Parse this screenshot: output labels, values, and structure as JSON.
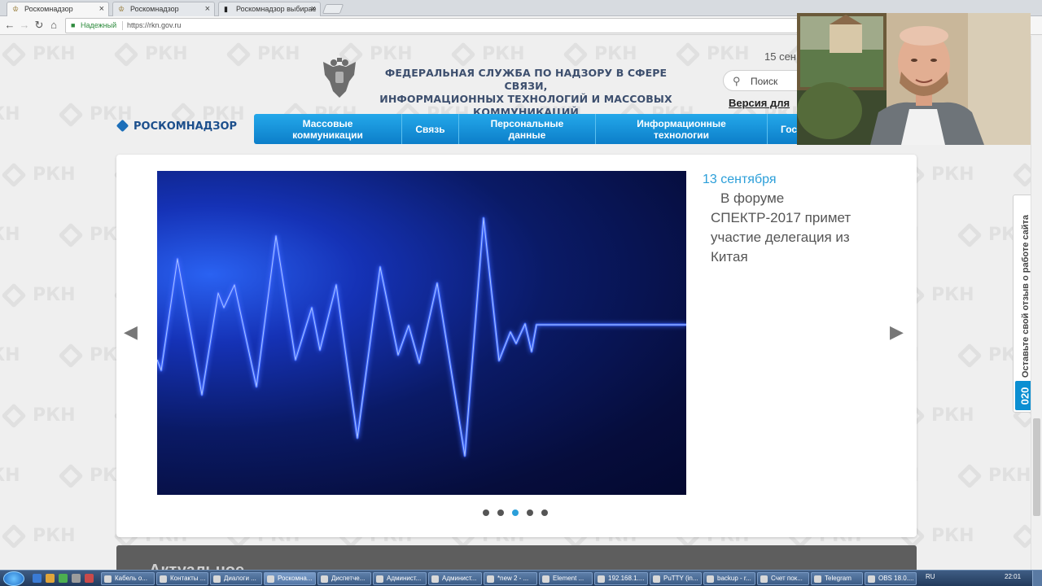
{
  "browser": {
    "tabs": [
      {
        "label": "Роскомнадзор",
        "icon": "emblem-icon",
        "active": true
      },
      {
        "label": "Роскомнадзор",
        "icon": "emblem-icon",
        "active": false
      },
      {
        "label": "Роскомнадзор выбирае",
        "icon": "page-icon",
        "active": false
      }
    ],
    "secure_label": "Надежный",
    "url": "https://rkn.gov.ru"
  },
  "header": {
    "watermark_text": "РКН",
    "agency_title_line1": "ФЕДЕРАЛЬНАЯ СЛУЖБА ПО НАДЗОРУ В СФЕРЕ СВЯЗИ,",
    "agency_title_line2": "ИНФОРМАЦИОННЫХ ТЕХНОЛОГИЙ И МАССОВЫХ КОММУНИКАЦИЙ",
    "date": "15 сен",
    "search_label": "Поиск",
    "version_link": "Версия для",
    "logo_text": "РОСКОМНАДЗОР"
  },
  "menu": [
    {
      "line1": "Массовые",
      "line2": "коммуникации"
    },
    {
      "line1": "Связь",
      "line2": ""
    },
    {
      "line1": "Персональные",
      "line2": "данные"
    },
    {
      "line1": "Информационные",
      "line2": "технологии"
    },
    {
      "line1": "Гос",
      "line2": ""
    }
  ],
  "slider": {
    "date": "13 сентября",
    "title": "В форуме СПЕКТР-2017 примет участие делегация из Китая",
    "dots_total": 5,
    "active_dot": 3
  },
  "section_heading": "Актуальное",
  "feedback": {
    "text": "Оставьте свой отзыв о работе сайта",
    "badge": "020"
  },
  "taskbar": {
    "items": [
      "Кабель о...",
      "Контакты ...",
      "Диалоги ...",
      "Роскомна...",
      "Диспетче...",
      "Админист...",
      "Админист...",
      "*new 2 - ...",
      "Element ...",
      "192.168.1....",
      "PuTTY (in...",
      "backup - r...",
      "Счет пок...",
      "Telegram",
      "OBS 18.0...."
    ],
    "language": "RU",
    "clock": "22:01"
  },
  "colors": {
    "menu_blue": "#1495dc",
    "logo_blue": "#1c4f8c",
    "date_blue": "#2c9fd9",
    "title_navy": "#3d4f6e"
  }
}
